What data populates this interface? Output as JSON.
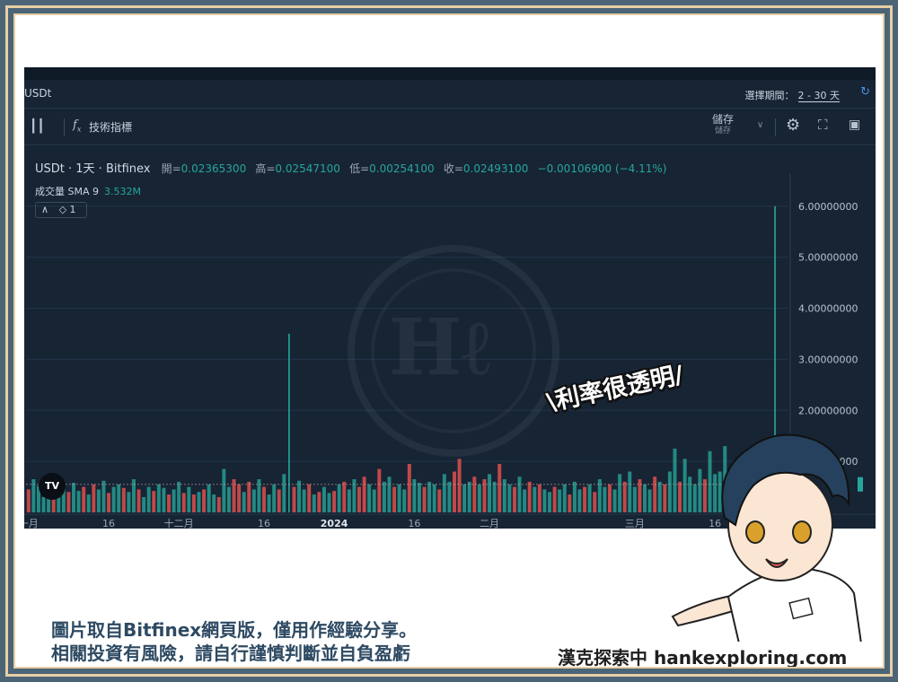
{
  "pair_bar": {
    "pair": "USDt",
    "period_label": "選擇期間：",
    "period_value": "2 - 30 天"
  },
  "toolbar": {
    "indicators_label": "技術指標",
    "save_label": "儲存",
    "save_sublabel": "儲存"
  },
  "legend": {
    "symbol": "USDt · 1天 · Bitfinex",
    "open_label": "開=",
    "open": "0.02365300",
    "high_label": "高=",
    "high": "0.02547100",
    "low_label": "低=",
    "low": "0.00254100",
    "close_label": "收=",
    "close": "0.02493100",
    "change": "−0.00106900 (−4.11%)",
    "volume_label": "成交量 SMA 9",
    "volume_value": "3.532M",
    "layers_count": "1"
  },
  "tv_logo": "TV",
  "overlay": {
    "bubble_text": "\\利率很透明/",
    "caption_line1": "圖片取自Bitfinex網頁版，僅用作經驗分享。",
    "caption_line2": "相關投資有風險，請自行謹慎判斷並自負盈虧",
    "brand": "漢克探索中 hankexploring.com"
  },
  "colors": {
    "up": "#26a69a",
    "down": "#ef5350",
    "background": "#172434",
    "frame": "#e7cfa6"
  },
  "chart_data": {
    "type": "bar",
    "ylim": [
      0,
      6.4
    ],
    "y_ticks": [
      "6.00000000",
      "5.00000000",
      "4.00000000",
      "3.00000000",
      "2.00000000",
      "1.00000000"
    ],
    "y_tick_values": [
      6,
      5,
      4,
      3,
      2,
      1
    ],
    "x_tick_labels": [
      {
        "index": 0,
        "label": "一月"
      },
      {
        "index": 16,
        "label": "16"
      },
      {
        "index": 30,
        "label": "十二月"
      },
      {
        "index": 47,
        "label": "16"
      },
      {
        "index": 61,
        "label": "2024"
      },
      {
        "index": 77,
        "label": "16"
      },
      {
        "index": 92,
        "label": "二月"
      },
      {
        "index": 121,
        "label": "三月"
      },
      {
        "index": 137,
        "label": "16"
      }
    ],
    "values": [
      0.45,
      0.65,
      0.52,
      0.3,
      0.6,
      0.35,
      0.55,
      0.5,
      0.4,
      0.58,
      0.42,
      0.5,
      0.35,
      0.55,
      0.45,
      0.62,
      0.38,
      0.5,
      0.55,
      0.48,
      0.4,
      0.65,
      0.45,
      0.3,
      0.5,
      0.42,
      0.55,
      0.48,
      0.35,
      0.45,
      0.6,
      0.38,
      0.5,
      0.35,
      0.4,
      0.45,
      0.55,
      0.35,
      0.3,
      0.85,
      0.5,
      0.65,
      0.55,
      0.4,
      0.6,
      0.45,
      0.65,
      0.5,
      0.35,
      0.55,
      0.45,
      0.75,
      3.5,
      0.5,
      0.62,
      0.45,
      0.55,
      0.35,
      0.4,
      0.5,
      0.38,
      0.42,
      0.55,
      0.6,
      0.45,
      0.65,
      0.5,
      0.7,
      0.55,
      0.45,
      0.85,
      0.6,
      0.7,
      0.5,
      0.55,
      0.45,
      0.95,
      0.65,
      0.58,
      0.5,
      0.6,
      0.55,
      0.45,
      0.75,
      0.6,
      0.8,
      1.05,
      0.55,
      0.6,
      0.7,
      0.55,
      0.65,
      0.75,
      0.6,
      0.95,
      0.65,
      0.55,
      0.5,
      0.7,
      0.45,
      0.6,
      0.5,
      0.55,
      0.45,
      0.4,
      0.5,
      0.45,
      0.55,
      0.35,
      0.6,
      0.45,
      0.5,
      0.55,
      0.4,
      0.65,
      0.5,
      0.55,
      0.45,
      0.75,
      0.6,
      0.8,
      0.5,
      0.65,
      0.55,
      0.45,
      0.7,
      0.6,
      0.55,
      0.8,
      1.25,
      0.6,
      1.05,
      0.7,
      0.55,
      0.85,
      0.65,
      1.2,
      0.75,
      0.8,
      1.3,
      0.65,
      0.55,
      0.75,
      0.5,
      0.6,
      0.45,
      0.7,
      0.55,
      0.4,
      6.0,
      0.55,
      0.65
    ],
    "directions": [
      "down",
      "up",
      "up",
      "up",
      "up",
      "down",
      "up",
      "up",
      "down",
      "up",
      "up",
      "down",
      "up",
      "down",
      "up",
      "up",
      "down",
      "up",
      "up",
      "down",
      "up",
      "up",
      "down",
      "up",
      "up",
      "down",
      "up",
      "up",
      "down",
      "up",
      "up",
      "down",
      "up",
      "down",
      "up",
      "down",
      "up",
      "up",
      "down",
      "up",
      "up",
      "down",
      "down",
      "up",
      "down",
      "up",
      "up",
      "down",
      "up",
      "up",
      "down",
      "up",
      "up",
      "down",
      "up",
      "up",
      "down",
      "up",
      "down",
      "up",
      "up",
      "down",
      "up",
      "down",
      "up",
      "up",
      "down",
      "down",
      "up",
      "up",
      "down",
      "up",
      "up",
      "down",
      "up",
      "up",
      "down",
      "up",
      "up",
      "down",
      "up",
      "up",
      "down",
      "up",
      "up",
      "down",
      "down",
      "up",
      "up",
      "down",
      "up",
      "down",
      "up",
      "up",
      "down",
      "up",
      "up",
      "down",
      "up",
      "up",
      "down",
      "up",
      "down",
      "up",
      "up",
      "down",
      "up",
      "up",
      "down",
      "up",
      "up",
      "down",
      "up",
      "down",
      "up",
      "up",
      "down",
      "up",
      "up",
      "down",
      "up",
      "up",
      "down",
      "up",
      "up",
      "down",
      "up",
      "down",
      "up",
      "up",
      "down",
      "up",
      "up",
      "up",
      "up",
      "down",
      "up",
      "up",
      "up",
      "up",
      "down",
      "up",
      "up",
      "up",
      "down",
      "up",
      "up",
      "up",
      "up",
      "up",
      "down",
      "up"
    ],
    "sma_level": 0.55
  }
}
